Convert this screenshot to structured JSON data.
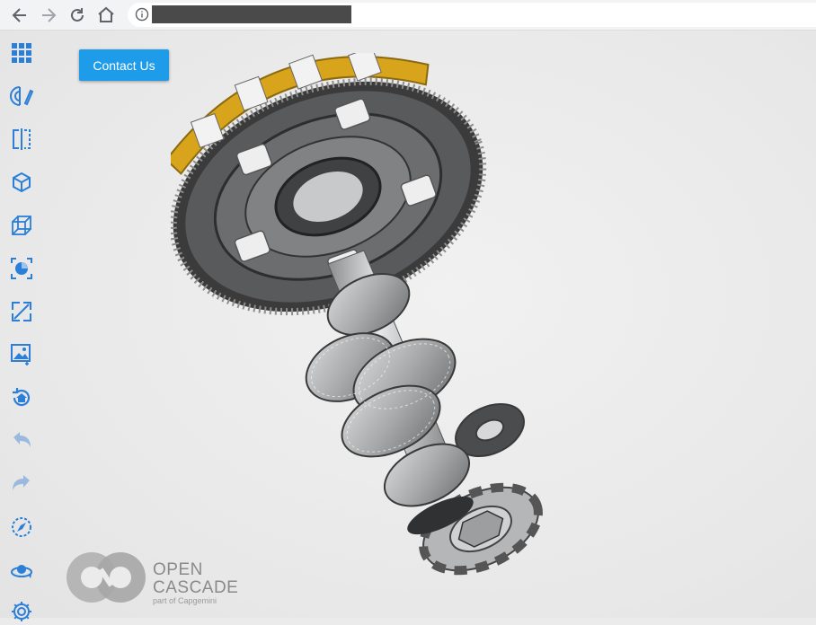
{
  "browser": {
    "back_icon": "arrow-left-icon",
    "forward_icon": "arrow-right-icon",
    "reload_icon": "reload-icon",
    "home_icon": "home-icon",
    "info_icon": "info-circle-icon",
    "url_redacted": true
  },
  "sidebar": {
    "items": [
      {
        "icon": "grid-menu-icon"
      },
      {
        "icon": "measure-tool-icon"
      },
      {
        "icon": "section-plane-icon"
      },
      {
        "icon": "shaded-box-icon"
      },
      {
        "icon": "wireframe-box-icon"
      },
      {
        "icon": "color-palette-icon"
      },
      {
        "icon": "fit-all-icon"
      },
      {
        "icon": "screenshot-icon"
      },
      {
        "icon": "reset-view-icon"
      },
      {
        "icon": "undo-icon"
      },
      {
        "icon": "redo-icon"
      },
      {
        "icon": "compass-icon"
      },
      {
        "icon": "rotate-icon"
      },
      {
        "icon": "settings-gear-icon"
      }
    ]
  },
  "viewer": {
    "contact_label": "Contact Us",
    "model": "gear-shaft-assembly"
  },
  "logo": {
    "line1": "OPEN",
    "line2": "CASCADE",
    "line3": "part of Capgemini"
  },
  "colors": {
    "accent": "#1e9be9",
    "sidebar_icon": "#2b7fd8",
    "disabled_icon": "#9bb9de",
    "background": "#ebebeb"
  }
}
